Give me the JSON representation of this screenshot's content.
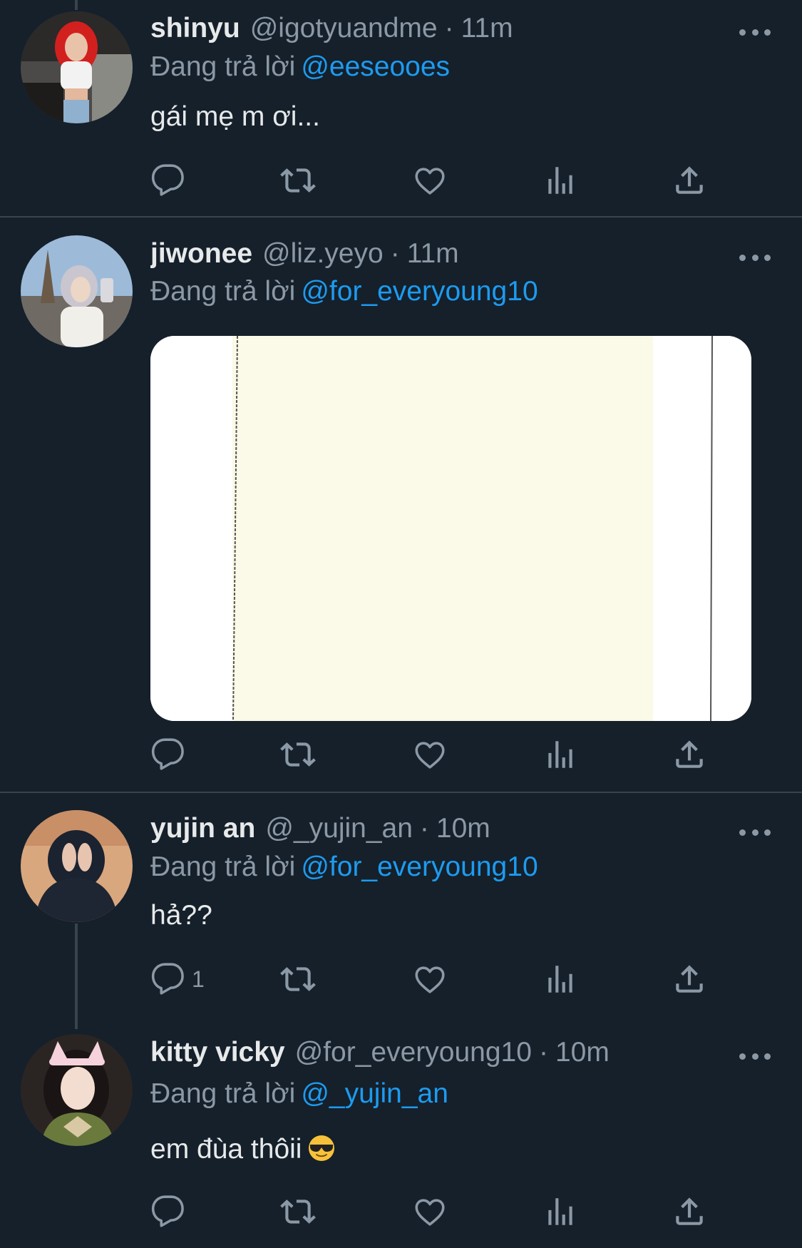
{
  "tweets": [
    {
      "name": "shinyu",
      "handle": "@igotyuandme",
      "separator": "·",
      "time": "11m",
      "reply_prefix": "Đang trả lời",
      "reply_to": "@eeseooes",
      "text": "gái mẹ m ơi...",
      "reply_count": ""
    },
    {
      "name": "jiwonee",
      "handle": "@liz.yeyo",
      "separator": "·",
      "time": "11m",
      "reply_prefix": "Đang trả lời",
      "reply_to": "@for_everyoung10",
      "reply_count": ""
    },
    {
      "name": "yujin an",
      "handle": "@_yujin_an",
      "separator": "·",
      "time": "10m",
      "reply_prefix": "Đang trả lời",
      "reply_to": "@for_everyoung10",
      "text": "hả??",
      "reply_count": "1"
    },
    {
      "name": "kitty vicky",
      "handle": "@for_everyoung10",
      "separator": "·",
      "time": "10m",
      "reply_prefix": "Đang trả lời",
      "reply_to": "@_yujin_an",
      "text": "em đùa thôii",
      "reply_count": ""
    }
  ],
  "colors": {
    "background": "#15202b",
    "text": "#e7e9ea",
    "secondary": "#8b98a5",
    "accent": "#1d9bf0",
    "divider": "#38444d"
  },
  "icons": [
    "reply-icon",
    "retweet-icon",
    "like-icon",
    "views-icon",
    "share-icon",
    "more-icon",
    "sunglasses-emoji-icon"
  ]
}
